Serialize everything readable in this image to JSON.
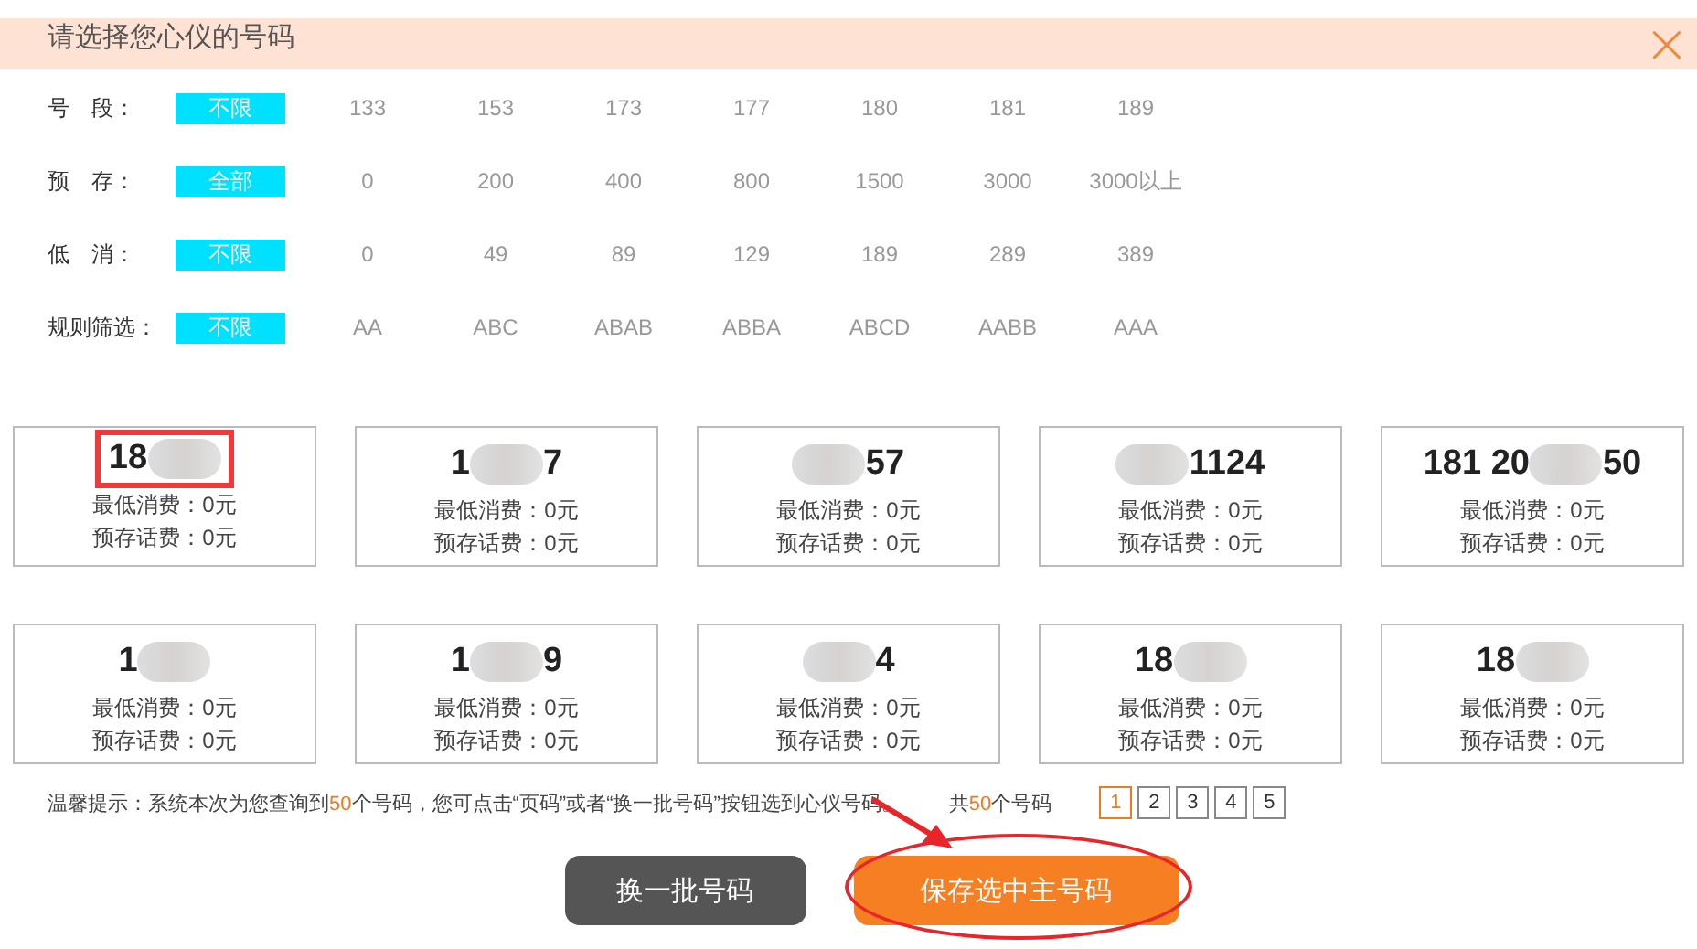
{
  "dialog": {
    "title": "请选择您心仪的号码",
    "close": "×"
  },
  "filters": [
    {
      "label": "号　段：",
      "options": [
        {
          "text": "不限",
          "selected": true
        },
        {
          "text": "133",
          "selected": false
        },
        {
          "text": "153",
          "selected": false
        },
        {
          "text": "173",
          "selected": false
        },
        {
          "text": "177",
          "selected": false
        },
        {
          "text": "180",
          "selected": false
        },
        {
          "text": "181",
          "selected": false
        },
        {
          "text": "189",
          "selected": false
        }
      ]
    },
    {
      "label": "预　存：",
      "options": [
        {
          "text": "全部",
          "selected": true
        },
        {
          "text": "0",
          "selected": false
        },
        {
          "text": "200",
          "selected": false
        },
        {
          "text": "400",
          "selected": false
        },
        {
          "text": "800",
          "selected": false
        },
        {
          "text": "1500",
          "selected": false
        },
        {
          "text": "3000",
          "selected": false
        },
        {
          "text": "3000以上",
          "selected": false
        }
      ]
    },
    {
      "label": "低　消：",
      "options": [
        {
          "text": "不限",
          "selected": true
        },
        {
          "text": "0",
          "selected": false
        },
        {
          "text": "49",
          "selected": false
        },
        {
          "text": "89",
          "selected": false
        },
        {
          "text": "129",
          "selected": false
        },
        {
          "text": "189",
          "selected": false
        },
        {
          "text": "289",
          "selected": false
        },
        {
          "text": "389",
          "selected": false
        }
      ]
    },
    {
      "label": "规则筛选：",
      "options": [
        {
          "text": "不限",
          "selected": true
        },
        {
          "text": "AA",
          "selected": false
        },
        {
          "text": "ABC",
          "selected": false
        },
        {
          "text": "ABAB",
          "selected": false
        },
        {
          "text": "ABBA",
          "selected": false
        },
        {
          "text": "ABCD",
          "selected": false
        },
        {
          "text": "AABB",
          "selected": false
        },
        {
          "text": "AAA",
          "selected": false
        }
      ]
    }
  ],
  "numbers": [
    {
      "number_start": "18",
      "min_spend": "最低消费：0元",
      "prepaid": "预存话费：0元",
      "highlighted": true
    },
    {
      "number_start": "1",
      "number_end": "7",
      "min_spend": "最低消费：0元",
      "prepaid": "预存话费：0元",
      "highlighted": false
    },
    {
      "number_end": "57",
      "min_spend": "最低消费：0元",
      "prepaid": "预存话费：0元",
      "highlighted": false
    },
    {
      "number_end": "1124",
      "min_spend": "最低消费：0元",
      "prepaid": "预存话费：0元",
      "highlighted": false
    },
    {
      "number_start": "181 20",
      "number_end": "50",
      "min_spend": "最低消费：0元",
      "prepaid": "预存话费：0元",
      "highlighted": false
    },
    {
      "number_start": "1",
      "min_spend": "最低消费：0元",
      "prepaid": "预存话费：0元",
      "highlighted": false
    },
    {
      "number_start": "1",
      "number_end": "9",
      "min_spend": "最低消费：0元",
      "prepaid": "预存话费：0元",
      "highlighted": false
    },
    {
      "number_end": "4",
      "min_spend": "最低消费：0元",
      "prepaid": "预存话费：0元",
      "highlighted": false
    },
    {
      "number_start": "18",
      "min_spend": "最低消费：0元",
      "prepaid": "预存话费：0元",
      "highlighted": false
    },
    {
      "number_start": "18",
      "min_spend": "最低消费：0元",
      "prepaid": "预存话费：0元",
      "highlighted": false
    }
  ],
  "tip": "温馨提示：系统本次为您查询到**50**个号码，您可点击“页码”或者“换一批号码”按钮选到心仪号码。",
  "total": "共**50**个号码",
  "pages": [
    {
      "text": "1",
      "selected": true
    },
    {
      "text": "2",
      "selected": false
    },
    {
      "text": "3",
      "selected": false
    },
    {
      "text": "4",
      "selected": false
    },
    {
      "text": "5",
      "selected": false
    }
  ],
  "buttons": [
    {
      "text": "换一批号码",
      "kind": "secondary",
      "circled": false
    },
    {
      "text": "保存选中主号码",
      "kind": "primary",
      "circled": true
    }
  ],
  "pointer_arrow": true
}
